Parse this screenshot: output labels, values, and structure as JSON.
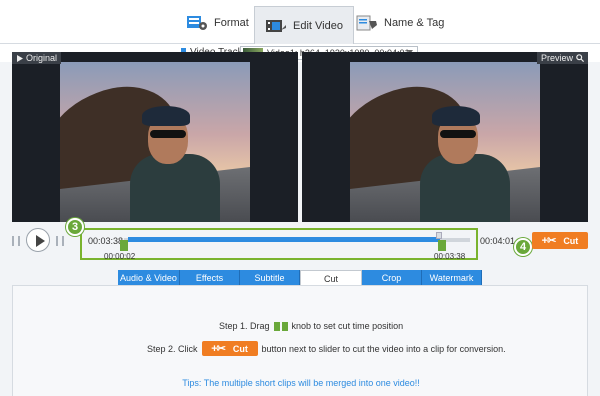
{
  "top_tabs": [
    {
      "label": "Format",
      "icon": "format-icon"
    },
    {
      "label": "Edit Video",
      "icon": "film-edit-icon",
      "active": true
    },
    {
      "label": "Name & Tag",
      "icon": "tag-icon"
    }
  ],
  "track": {
    "label": "Video Track:",
    "selected": "Video1: h264, 1920x1080, 00:04:01"
  },
  "preview": {
    "original_label": "Original",
    "preview_label": "Preview"
  },
  "timeline": {
    "current_time": "00:03:38",
    "start_time": "00:00:02",
    "end_time": "00:03:38",
    "total_time": "00:04:01",
    "cut_label": "Cut",
    "badge_3": "3",
    "badge_4": "4"
  },
  "sub_tabs": [
    {
      "label": "Audio & Video"
    },
    {
      "label": "Effects"
    },
    {
      "label": "Subtitle"
    },
    {
      "label": "Cut",
      "active": true
    },
    {
      "label": "Crop"
    },
    {
      "label": "Watermark"
    }
  ],
  "instructions": {
    "step1_prefix": "Step 1. Drag",
    "step1_suffix": "knob to set cut time position",
    "step2_prefix": "Step 2. Click",
    "step2_button": "Cut",
    "step2_suffix": "button next to slider to cut the video into a clip for conversion.",
    "tips": "Tips: The multiple short clips will be merged into one video!!"
  },
  "colors": {
    "accent_blue": "#2d8be0",
    "cut_orange": "#f07d22",
    "highlight_green": "#6aa83a"
  }
}
